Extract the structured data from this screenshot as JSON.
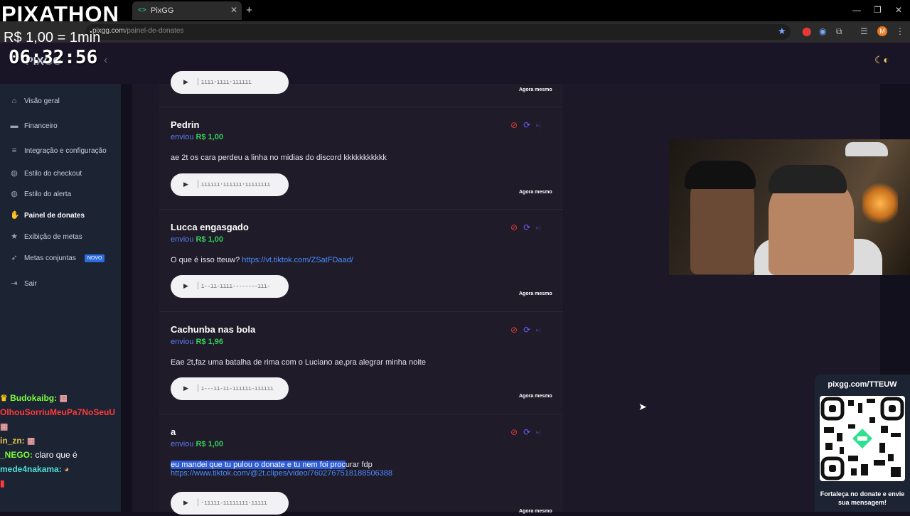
{
  "stream": {
    "title": "PIXATHON",
    "rate": "R$ 1,00 = 1min",
    "timer": "06:32:56"
  },
  "browser": {
    "tab_title": "PixGG",
    "url_host": "pixgg.com",
    "url_path": "/painel-de-donates",
    "profile_initial": "M"
  },
  "app": {
    "logo": "PIXGG"
  },
  "sidebar": {
    "items": [
      {
        "label": "Visão geral",
        "icon": "home-icon"
      },
      {
        "label": "Financeiro",
        "icon": "wallet-icon"
      },
      {
        "label": "Integração e configuração",
        "icon": "settings-icon"
      },
      {
        "label": "Estilo do checkout",
        "icon": "palette-icon"
      },
      {
        "label": "Estilo do alerta",
        "icon": "palette-icon"
      },
      {
        "label": "Painel de donates",
        "icon": "hand-coins-icon"
      },
      {
        "label": "Exibição de metas",
        "icon": "star-icon"
      },
      {
        "label": "Metas conjuntas",
        "icon": "rocket-icon",
        "badge": "NOVO"
      },
      {
        "label": "Sair",
        "icon": "logout-icon"
      }
    ]
  },
  "donations": [
    {
      "name": "",
      "sent": "",
      "amount": "",
      "message": "",
      "time": "Agora mesmo"
    },
    {
      "name": "Pedrin",
      "sent": "enviou",
      "amount": "R$ 1,00",
      "message": "ae 2t os cara perdeu a linha no midias do discord kkkkkkkkkkk",
      "time": "Agora mesmo"
    },
    {
      "name": "Lucca engasgado",
      "sent": "enviou",
      "amount": "R$ 1,00",
      "message": "O que é isso tteuw?",
      "link": "https://vt.tiktok.com/ZSatFDaad/",
      "time": "Agora mesmo"
    },
    {
      "name": "Cachunba nas bola",
      "sent": "enviou",
      "amount": "R$ 1,96",
      "message": "Eae 2t,faz uma batalha de rima com o Luciano ae,pra alegrar minha noite",
      "time": "Agora mesmo"
    },
    {
      "name": "a",
      "sent": "enviou",
      "amount": "R$ 1,00",
      "message_highlight": "eu mandei que tu pulou o donate e tu nem foi proc",
      "message_rest": "urar fdp",
      "link": "https://www.tiktok.com/@2t.clipes/video/7602767518188506388",
      "time": "Agora mesmo"
    }
  ],
  "chat": [
    {
      "user": "Budokaibg:",
      "text": "",
      "color": "#7cfc3a"
    },
    {
      "user": "OlhouSorriuMeuPa7NoSeuU",
      "text": "",
      "color": "#ff3b3b"
    },
    {
      "user": "in_zn:",
      "text": "",
      "color": "#e8c34a"
    },
    {
      "user": "_NEGO:",
      "text": "claro que é",
      "color": "#7cfc3a"
    },
    {
      "user": "mede4nakama:",
      "text": "",
      "color": "#4be0d6"
    }
  ],
  "qr": {
    "url": "pixgg.com/TTEUW",
    "cta": "Fortaleça no donate e envie sua mensagem!"
  },
  "colors": {
    "accent_green": "#34d058",
    "accent_blue": "#5b7cf0",
    "ban_red": "#e53935",
    "sidebar_bg": "#1c2333"
  }
}
